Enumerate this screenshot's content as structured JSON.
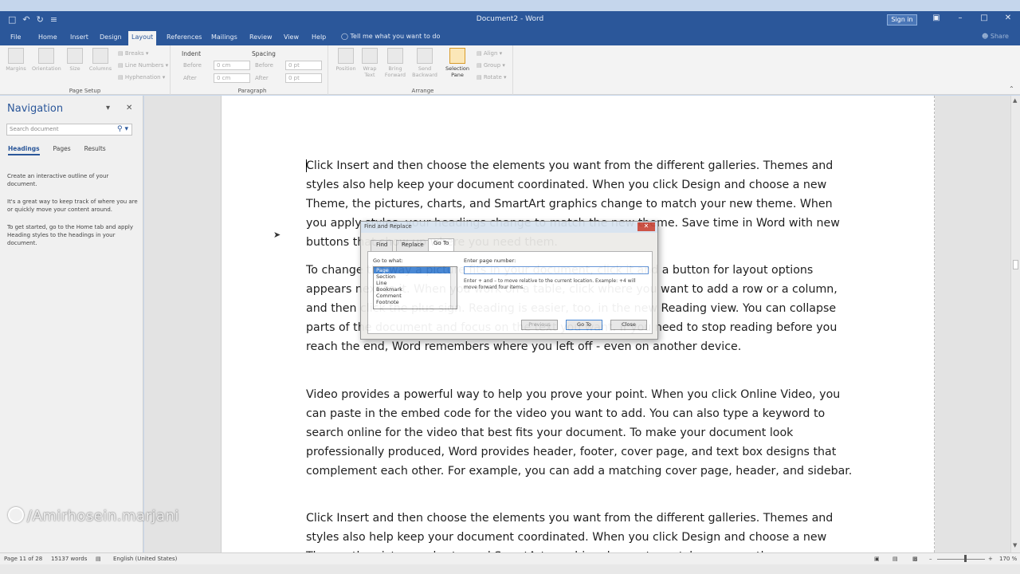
{
  "window": {
    "title": "Document2 - Word",
    "sign_in": "Sign in",
    "qat": [
      "□",
      "↶",
      "↻",
      "≡"
    ],
    "controls": [
      "▣",
      "–",
      "□",
      "✕"
    ]
  },
  "tabs": [
    {
      "label": "File"
    },
    {
      "label": "Home"
    },
    {
      "label": "Insert"
    },
    {
      "label": "Design"
    },
    {
      "label": "Layout"
    },
    {
      "label": "References"
    },
    {
      "label": "Mailings"
    },
    {
      "label": "Review"
    },
    {
      "label": "View"
    },
    {
      "label": "Help"
    }
  ],
  "tell_me": "Tell me what you want to do",
  "share": "Share",
  "ribbon": {
    "page_setup": {
      "label": "Page Setup",
      "buttons": [
        "Margins",
        "Orientation",
        "Size",
        "Columns"
      ],
      "small": [
        "Breaks",
        "Line Numbers",
        "Hyphenation"
      ]
    },
    "paragraph": {
      "label": "Paragraph",
      "indent_title": "Indent",
      "spacing_title": "Spacing",
      "before_label": "Before",
      "after_label": "After",
      "indent_before": "0 cm",
      "indent_after": "0 cm",
      "spacing_before": "0 pt",
      "spacing_after": "0 pt"
    },
    "arrange": {
      "label": "Arrange",
      "buttons": [
        "Position",
        "Wrap Text",
        "Bring Forward",
        "Send Backward",
        "Selection Pane"
      ],
      "small": [
        "Align",
        "Group",
        "Rotate"
      ]
    }
  },
  "nav": {
    "title": "Navigation",
    "search_placeholder": "Search document",
    "tabs": [
      "Headings",
      "Pages",
      "Results"
    ],
    "help": [
      "Create an interactive outline of your document.",
      "It's a great way to keep track of where you are or quickly move your content around.",
      "To get started, go to the Home tab and apply Heading styles to the headings in your document."
    ]
  },
  "document": {
    "paragraphs": [
      "Click Insert and then choose the elements you want from the different galleries. Themes and styles also help keep your document coordinated. When you click Design and choose a new Theme, the pictures, charts, and SmartArt graphics change to match your new theme. When you apply styles, your headings change to match the new theme. Save time in Word with new buttons that show up where you need them.",
      "To change the way a picture fits in your document, click it and a button for layout options appears next to it. When you work on a table, click where you want to add a row or a column, and then click the plus sign. Reading is easier, too, in the new Reading view. You can collapse parts of the document and focus on the text you want. If you need to stop reading before you reach the end, Word remembers where you left off - even on another device.",
      "Video provides a powerful way to help you prove your point. When you click Online Video, you can paste in the embed code for the video you want to add. You can also type a keyword to search online for the video that best fits your document. To make your document look professionally produced, Word provides header, footer, cover page, and text box designs that complement each other. For example, you can add a matching cover page, header, and sidebar.",
      "Click Insert and then choose the elements you want from the different galleries. Themes and styles also help keep your document coordinated. When you click Design and choose a new Theme, the pictures, charts, and SmartArt graphics change to match your new theme."
    ]
  },
  "dialog": {
    "title": "Find and Replace",
    "tabs": [
      "Find",
      "Replace",
      "Go To"
    ],
    "go_to_what_label": "Go to what:",
    "go_to_items": [
      "Page",
      "Section",
      "Line",
      "Bookmark",
      "Comment",
      "Footnote"
    ],
    "enter_label": "Enter page number:",
    "hint": "Enter + and – to move relative to the current location. Example: +4 will move forward four items.",
    "buttons": {
      "previous": "Previous",
      "go_to": "Go To",
      "close": "Close"
    }
  },
  "status": {
    "page": "Page 11 of 28",
    "words": "15137 words",
    "language": "English (United States)",
    "zoom": "170 %"
  },
  "watermark": "/Amirhosein.marjani"
}
